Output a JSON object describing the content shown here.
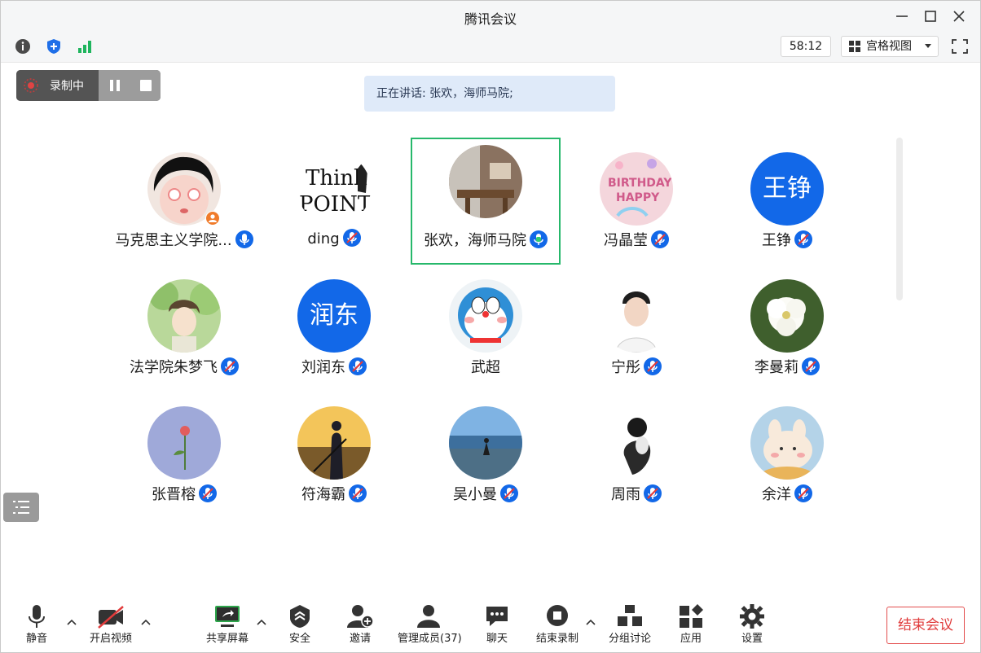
{
  "window": {
    "title": "腾讯会议"
  },
  "infobar": {
    "timer": "58:12",
    "view_label": "宫格视图"
  },
  "recording": {
    "label": "录制中"
  },
  "speaking_banner": "正在讲话: 张欢，海师马院;",
  "participants": [
    {
      "name": "马克思主义学院...",
      "mic": "on"
    },
    {
      "name": "ding",
      "mic": "muted"
    },
    {
      "name": "张欢，海师马院",
      "mic": "speaking",
      "active": true
    },
    {
      "name": "冯晶莹",
      "mic": "muted"
    },
    {
      "name": "王铮",
      "mic": "muted",
      "avatar_text": "王铮"
    },
    {
      "name": "法学院朱梦飞",
      "mic": "muted"
    },
    {
      "name": "刘润东",
      "mic": "muted",
      "avatar_text": "润东"
    },
    {
      "name": "武超",
      "mic": "none"
    },
    {
      "name": "宁彤",
      "mic": "muted"
    },
    {
      "name": "李曼莉",
      "mic": "muted"
    },
    {
      "name": "张晋榕",
      "mic": "muted"
    },
    {
      "name": "符海霸",
      "mic": "muted"
    },
    {
      "name": "吴小曼",
      "mic": "muted"
    },
    {
      "name": "周雨",
      "mic": "muted"
    },
    {
      "name": "余洋",
      "mic": "muted"
    }
  ],
  "toolbar": {
    "mute": "静音",
    "video": "开启视频",
    "share": "共享屏幕",
    "security": "安全",
    "invite": "邀请",
    "members": "管理成员(37)",
    "chat": "聊天",
    "end_record": "结束录制",
    "breakout": "分组讨论",
    "apps": "应用",
    "settings": "设置",
    "end_meeting": "结束会议"
  },
  "colors": {
    "accent": "#1268e8",
    "active_border": "#26b86b",
    "danger": "#e03b3b"
  }
}
